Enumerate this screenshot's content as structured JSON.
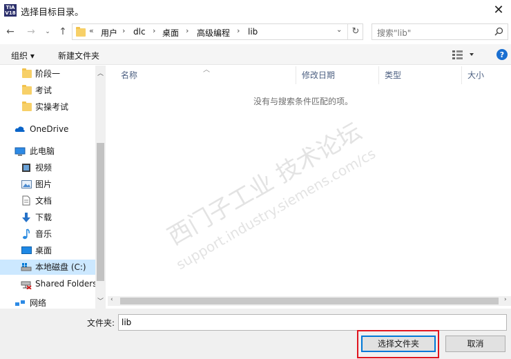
{
  "window": {
    "title": "选择目标目录。",
    "app_icon_text": "TIA"
  },
  "address": {
    "overflow": "«",
    "segments": [
      "用户",
      "dlc",
      "桌面",
      "高级编程",
      "lib"
    ]
  },
  "search": {
    "placeholder": "搜索\"lib\""
  },
  "toolbar": {
    "organize": "组织 ▾",
    "new_folder": "新建文件夹"
  },
  "nav": {
    "folders": [
      "阶段一",
      "考试",
      "实操考试"
    ],
    "onedrive": "OneDrive",
    "this_pc": "此电脑",
    "pc_items": [
      "视频",
      "图片",
      "文档",
      "下载",
      "音乐",
      "桌面",
      "本地磁盘 (C:)",
      "Shared Folders"
    ],
    "network": "网络"
  },
  "columns": [
    "名称",
    "修改日期",
    "类型",
    "大小"
  ],
  "empty_message": "没有与搜索条件匹配的项。",
  "watermark": {
    "line1": "西门子工业 技术论坛",
    "line2": "support.industry.siemens.com/cs"
  },
  "footer": {
    "folder_label": "文件夹:",
    "folder_value": "lib",
    "select_button": "选择文件夹",
    "cancel_button": "取消"
  },
  "colors": {
    "accent": "#0078d7",
    "highlight_box": "#e0141e",
    "selection": "#cce8ff"
  }
}
